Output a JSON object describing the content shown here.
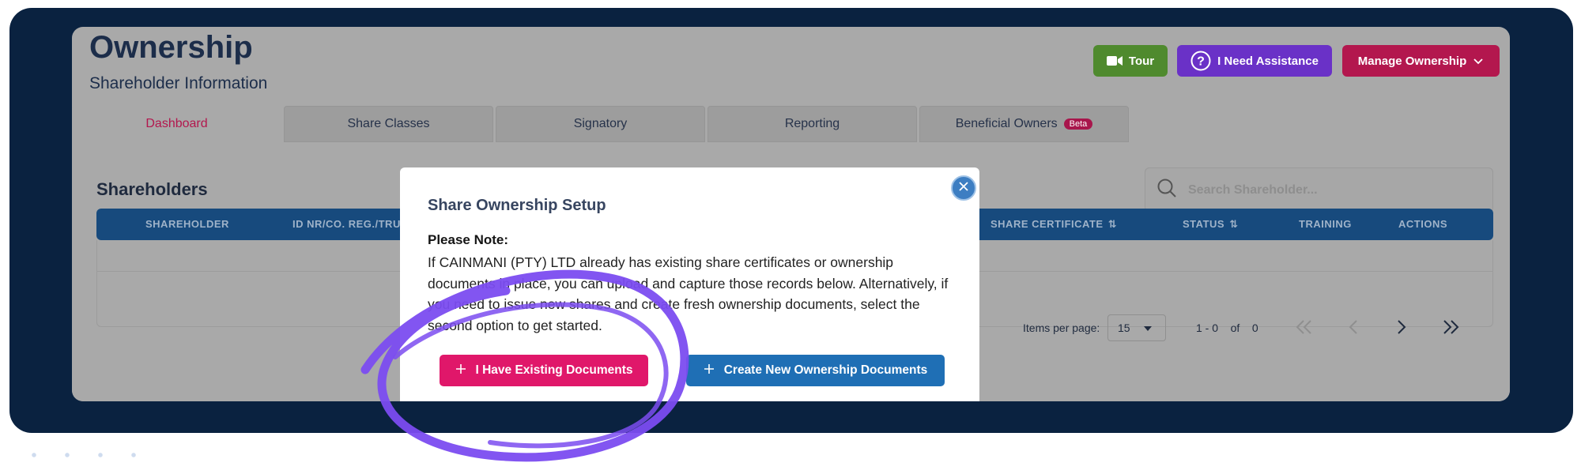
{
  "header": {
    "title": "Ownership",
    "subtitle": "Shareholder Information"
  },
  "actions": {
    "tour_label": "Tour",
    "assistance_label": "I Need Assistance",
    "manage_label": "Manage Ownership"
  },
  "tabs": [
    {
      "label": "Dashboard",
      "active": true
    },
    {
      "label": "Share Classes"
    },
    {
      "label": "Signatory"
    },
    {
      "label": "Reporting"
    },
    {
      "label": "Beneficial Owners",
      "badge": "Beta"
    }
  ],
  "shareholders": {
    "title": "Shareholders",
    "search_placeholder": "Search Shareholder...",
    "columns": {
      "shareholder": "SHAREHOLDER",
      "id_nr": "ID NR/CO. REG./TRUS",
      "share_certificate": "SHARE CERTIFICATE",
      "status": "STATUS",
      "training": "TRAINING",
      "actions": "ACTIONS"
    },
    "pagination": {
      "items_per_page_label": "Items per page:",
      "items_per_page_value": "15",
      "range": "1 - 0",
      "of_label": "of",
      "total": "0"
    }
  },
  "modal": {
    "title": "Share Ownership Setup",
    "note_label": "Please Note:",
    "body": "If CAINMANI (PTY) LTD already has existing share certificates or ownership documents in place, you can upload and capture those records below. Alternatively, if you need to issue new shares and create fresh ownership documents, select the second option to get started.",
    "existing_button": "I Have Existing Documents",
    "new_button": "Create New Ownership Documents"
  },
  "colors": {
    "frame": "#0a2240",
    "accent_pink": "#e0176a",
    "accent_blue": "#1f6fb5",
    "tour_green": "#4f8a2e",
    "assist_purple": "#6a31c7",
    "annotation": "#7b4cf0"
  },
  "icons": {
    "tour": "video-camera-icon",
    "assistance": "question-circle-icon",
    "manage": "chevron-down-icon",
    "search": "search-icon",
    "close": "close-icon",
    "sort": "sort-arrows-icon",
    "plus": "plus-icon"
  }
}
